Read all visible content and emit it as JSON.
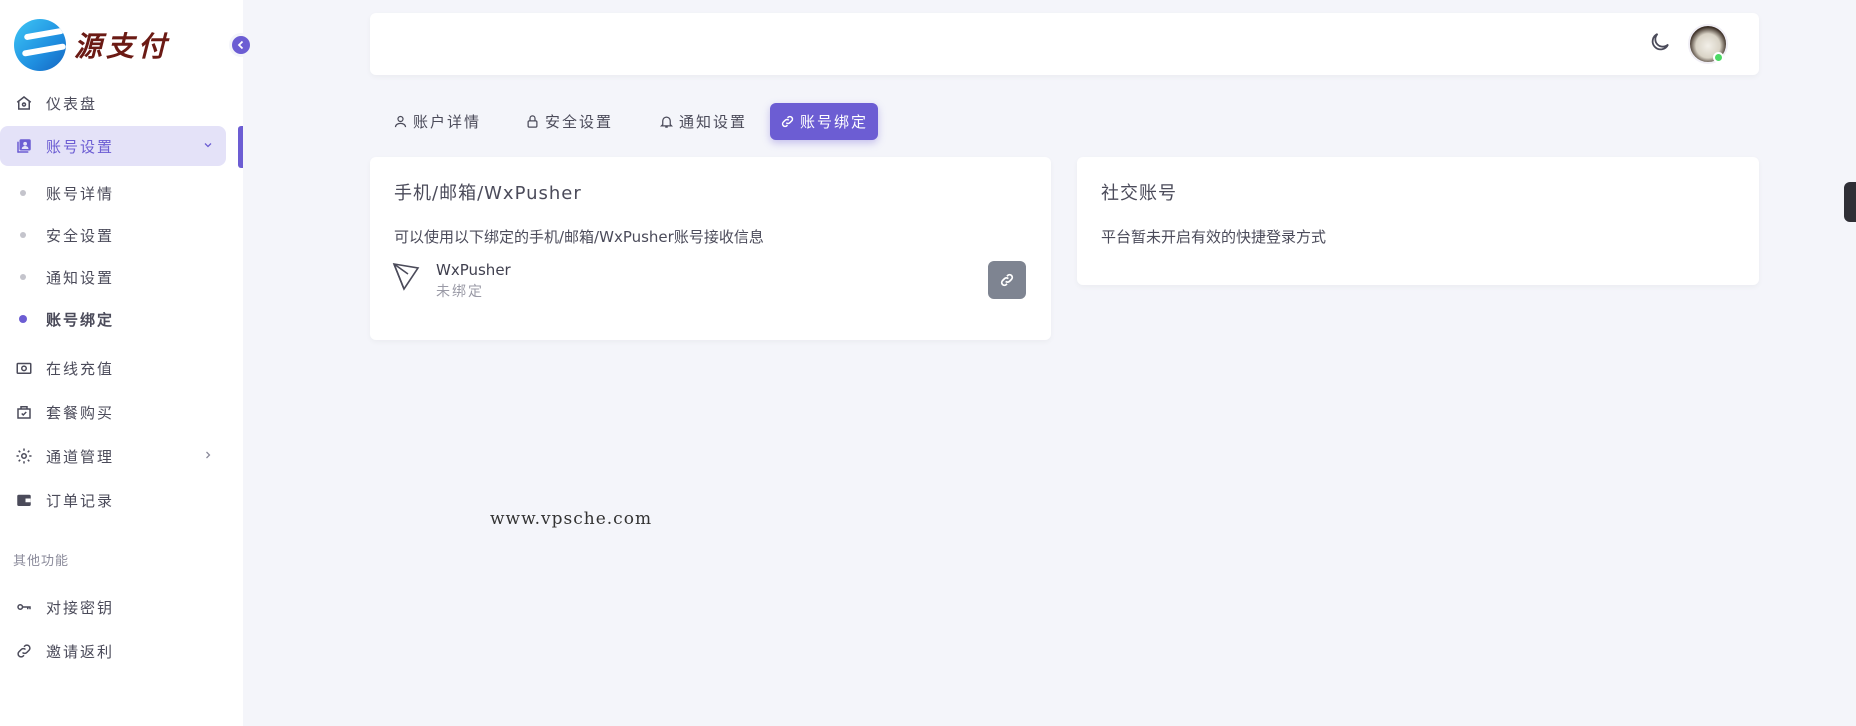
{
  "brand": {
    "name": "源支付"
  },
  "sidebar": {
    "items": [
      {
        "label": "仪表盘",
        "icon": "home-icon"
      },
      {
        "label": "账号设置",
        "icon": "account-icon",
        "active": true
      },
      {
        "label": "在线充值",
        "icon": "recharge-icon"
      },
      {
        "label": "套餐购买",
        "icon": "bag-icon"
      },
      {
        "label": "通道管理",
        "icon": "gear-icon"
      },
      {
        "label": "订单记录",
        "icon": "wallet-icon"
      }
    ],
    "sub_items": [
      {
        "label": "账号详情"
      },
      {
        "label": "安全设置"
      },
      {
        "label": "通知设置"
      },
      {
        "label": "账号绑定",
        "active": true
      }
    ],
    "section_label": "其他功能",
    "other_items": [
      {
        "label": "对接密钥",
        "icon": "key-icon"
      },
      {
        "label": "邀请返利",
        "icon": "link-icon"
      }
    ]
  },
  "tabs": [
    {
      "label": "账户详情",
      "icon": "user-icon"
    },
    {
      "label": "安全设置",
      "icon": "lock-icon"
    },
    {
      "label": "通知设置",
      "icon": "bell-icon"
    },
    {
      "label": "账号绑定",
      "icon": "link-icon",
      "active": true
    }
  ],
  "binding_card": {
    "title": "手机/邮箱/WxPusher",
    "description": "可以使用以下绑定的手机/邮箱/WxPusher账号接收信息",
    "item_name": "WxPusher",
    "item_status": "未绑定"
  },
  "social_card": {
    "title": "社交账号",
    "description": "平台暂未开启有效的快捷登录方式"
  },
  "watermark": "www.vpsche.com",
  "colors": {
    "accent": "#6c5dd3",
    "online": "#4cd964",
    "button_gray": "#7e8491"
  }
}
